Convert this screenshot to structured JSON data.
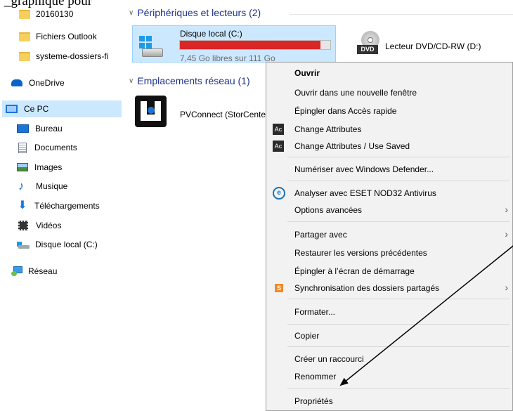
{
  "caption": "_graphique pour",
  "sidebar": {
    "items": [
      {
        "label": "20160130",
        "icon": "folder-icon"
      },
      {
        "label": "Fichiers Outlook",
        "icon": "folder-icon"
      },
      {
        "label": "systeme-dossiers-fi",
        "icon": "folder-icon"
      },
      {
        "label": "OneDrive",
        "icon": "cloud-icon"
      },
      {
        "label": "Ce PC",
        "icon": "computer-icon",
        "selected": true
      },
      {
        "label": "Bureau",
        "icon": "desktop-icon"
      },
      {
        "label": "Documents",
        "icon": "document-icon"
      },
      {
        "label": "Images",
        "icon": "image-icon"
      },
      {
        "label": "Musique",
        "icon": "music-icon"
      },
      {
        "label": "Téléchargements",
        "icon": "download-icon"
      },
      {
        "label": "Vidéos",
        "icon": "video-icon"
      },
      {
        "label": "Disque local (C:)",
        "icon": "drive-icon"
      },
      {
        "label": "Réseau",
        "icon": "network-icon"
      }
    ]
  },
  "main": {
    "devices_header": "Périphériques et lecteurs (2)",
    "drives": [
      {
        "name": "Disque local (C:)",
        "free_text": "7,45 Go libres sur 111 Go",
        "used_fraction": 0.933
      },
      {
        "name": "Lecteur DVD/CD-RW (D:)",
        "badge": "DVD"
      }
    ],
    "network_header": "Emplacements réseau (1)",
    "network_items": [
      {
        "name": "PVConnect (StorCenter)"
      }
    ]
  },
  "context_menu": {
    "items": [
      "Ouvrir",
      "Ouvrir dans une nouvelle fenêtre",
      "Épingler dans Accès rapide",
      "Change Attributes",
      "Change Attributes / Use Saved",
      "Numériser avec Windows Defender...",
      "Analyser avec ESET NOD32 Antivirus",
      "Options avancées",
      "Partager avec",
      "Restaurer les versions précédentes",
      "Épingler à l’écran de démarrage",
      "Synchronisation des dossiers partagés",
      "Formater...",
      "Copier",
      "Créer un raccourci",
      "Renommer",
      "Propriétés"
    ],
    "ac_badge": "Ac",
    "eset_badge": "e",
    "sync_badge": "S"
  },
  "colors": {
    "selection": "#cce8ff",
    "drive_bar_fill": "#da2626",
    "section_header": "#1e3287",
    "menu_bg": "#f2f2f2"
  }
}
